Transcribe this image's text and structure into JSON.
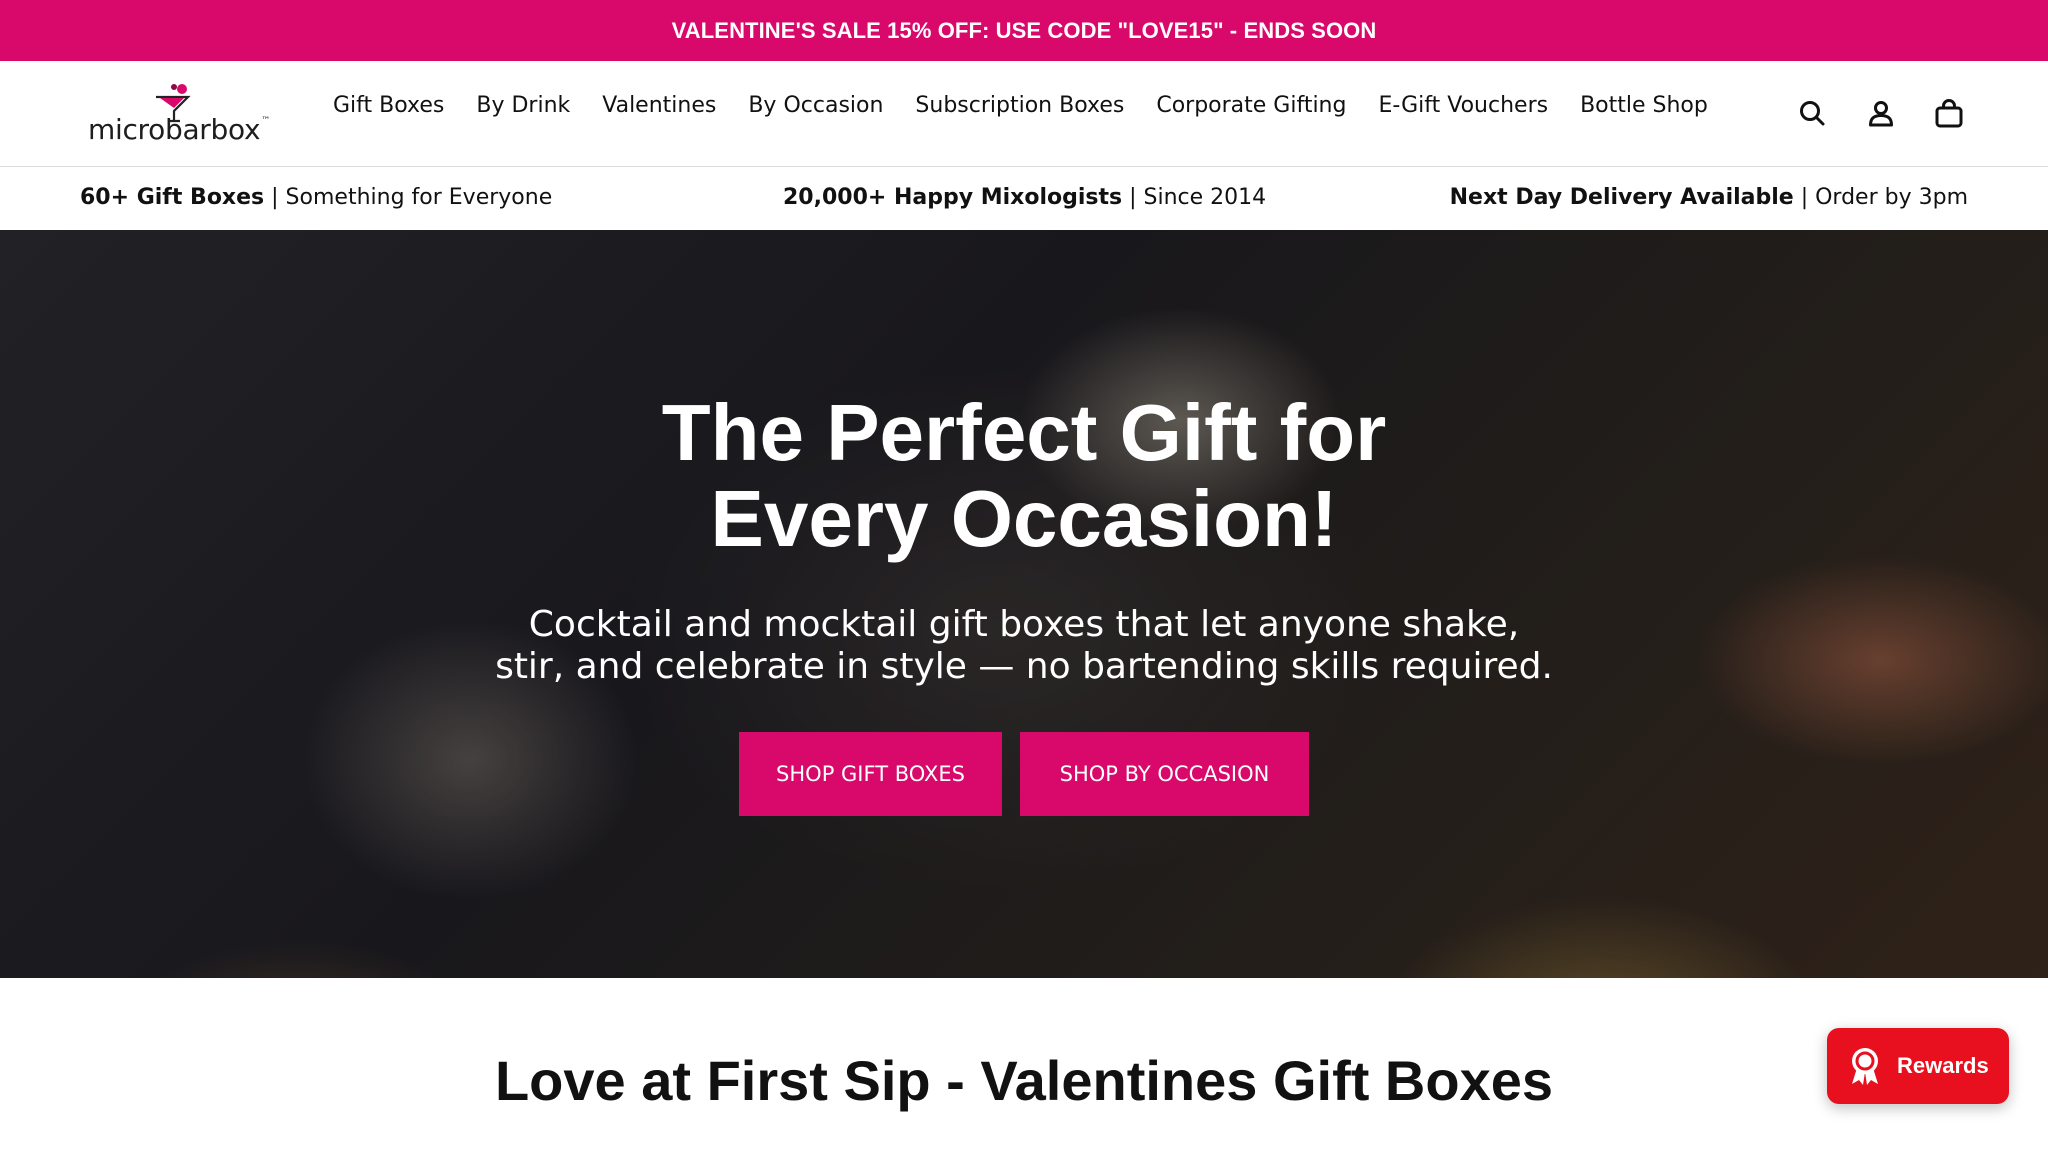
{
  "announcement": "VALENTINE'S SALE 15% OFF: USE CODE \"LOVE15\" - ENDS SOON",
  "brand": {
    "name": "microbarbox",
    "trademark": "™"
  },
  "nav": {
    "items": [
      "Gift Boxes",
      "By Drink",
      "Valentines",
      "By Occasion",
      "Subscription Boxes",
      "Corporate Gifting",
      "E-Gift Vouchers",
      "Bottle Shop"
    ]
  },
  "header_icons": [
    "search-icon",
    "account-icon",
    "cart-icon"
  ],
  "usp": [
    {
      "bold": "60+ Gift Boxes",
      "rest": " | Something for Everyone"
    },
    {
      "bold": "20,000+ Happy Mixologists",
      "rest": " | Since 2014"
    },
    {
      "bold": "Next Day Delivery Available",
      "rest": " | Order by 3pm"
    }
  ],
  "hero": {
    "title_line1": "The Perfect Gift for",
    "title_line2": "Every Occasion!",
    "subtitle_line1": "Cocktail and mocktail gift boxes that let anyone shake,",
    "subtitle_line2": "stir, and celebrate in style — no bartending skills required.",
    "buttons": [
      "SHOP GIFT BOXES",
      "SHOP BY OCCASION"
    ]
  },
  "section_title": "Love at First Sip - Valentines Gift Boxes",
  "rewards": {
    "label": "Rewards"
  },
  "colors": {
    "brand_pink": "#d8096b",
    "rewards_red": "#e8101e"
  }
}
